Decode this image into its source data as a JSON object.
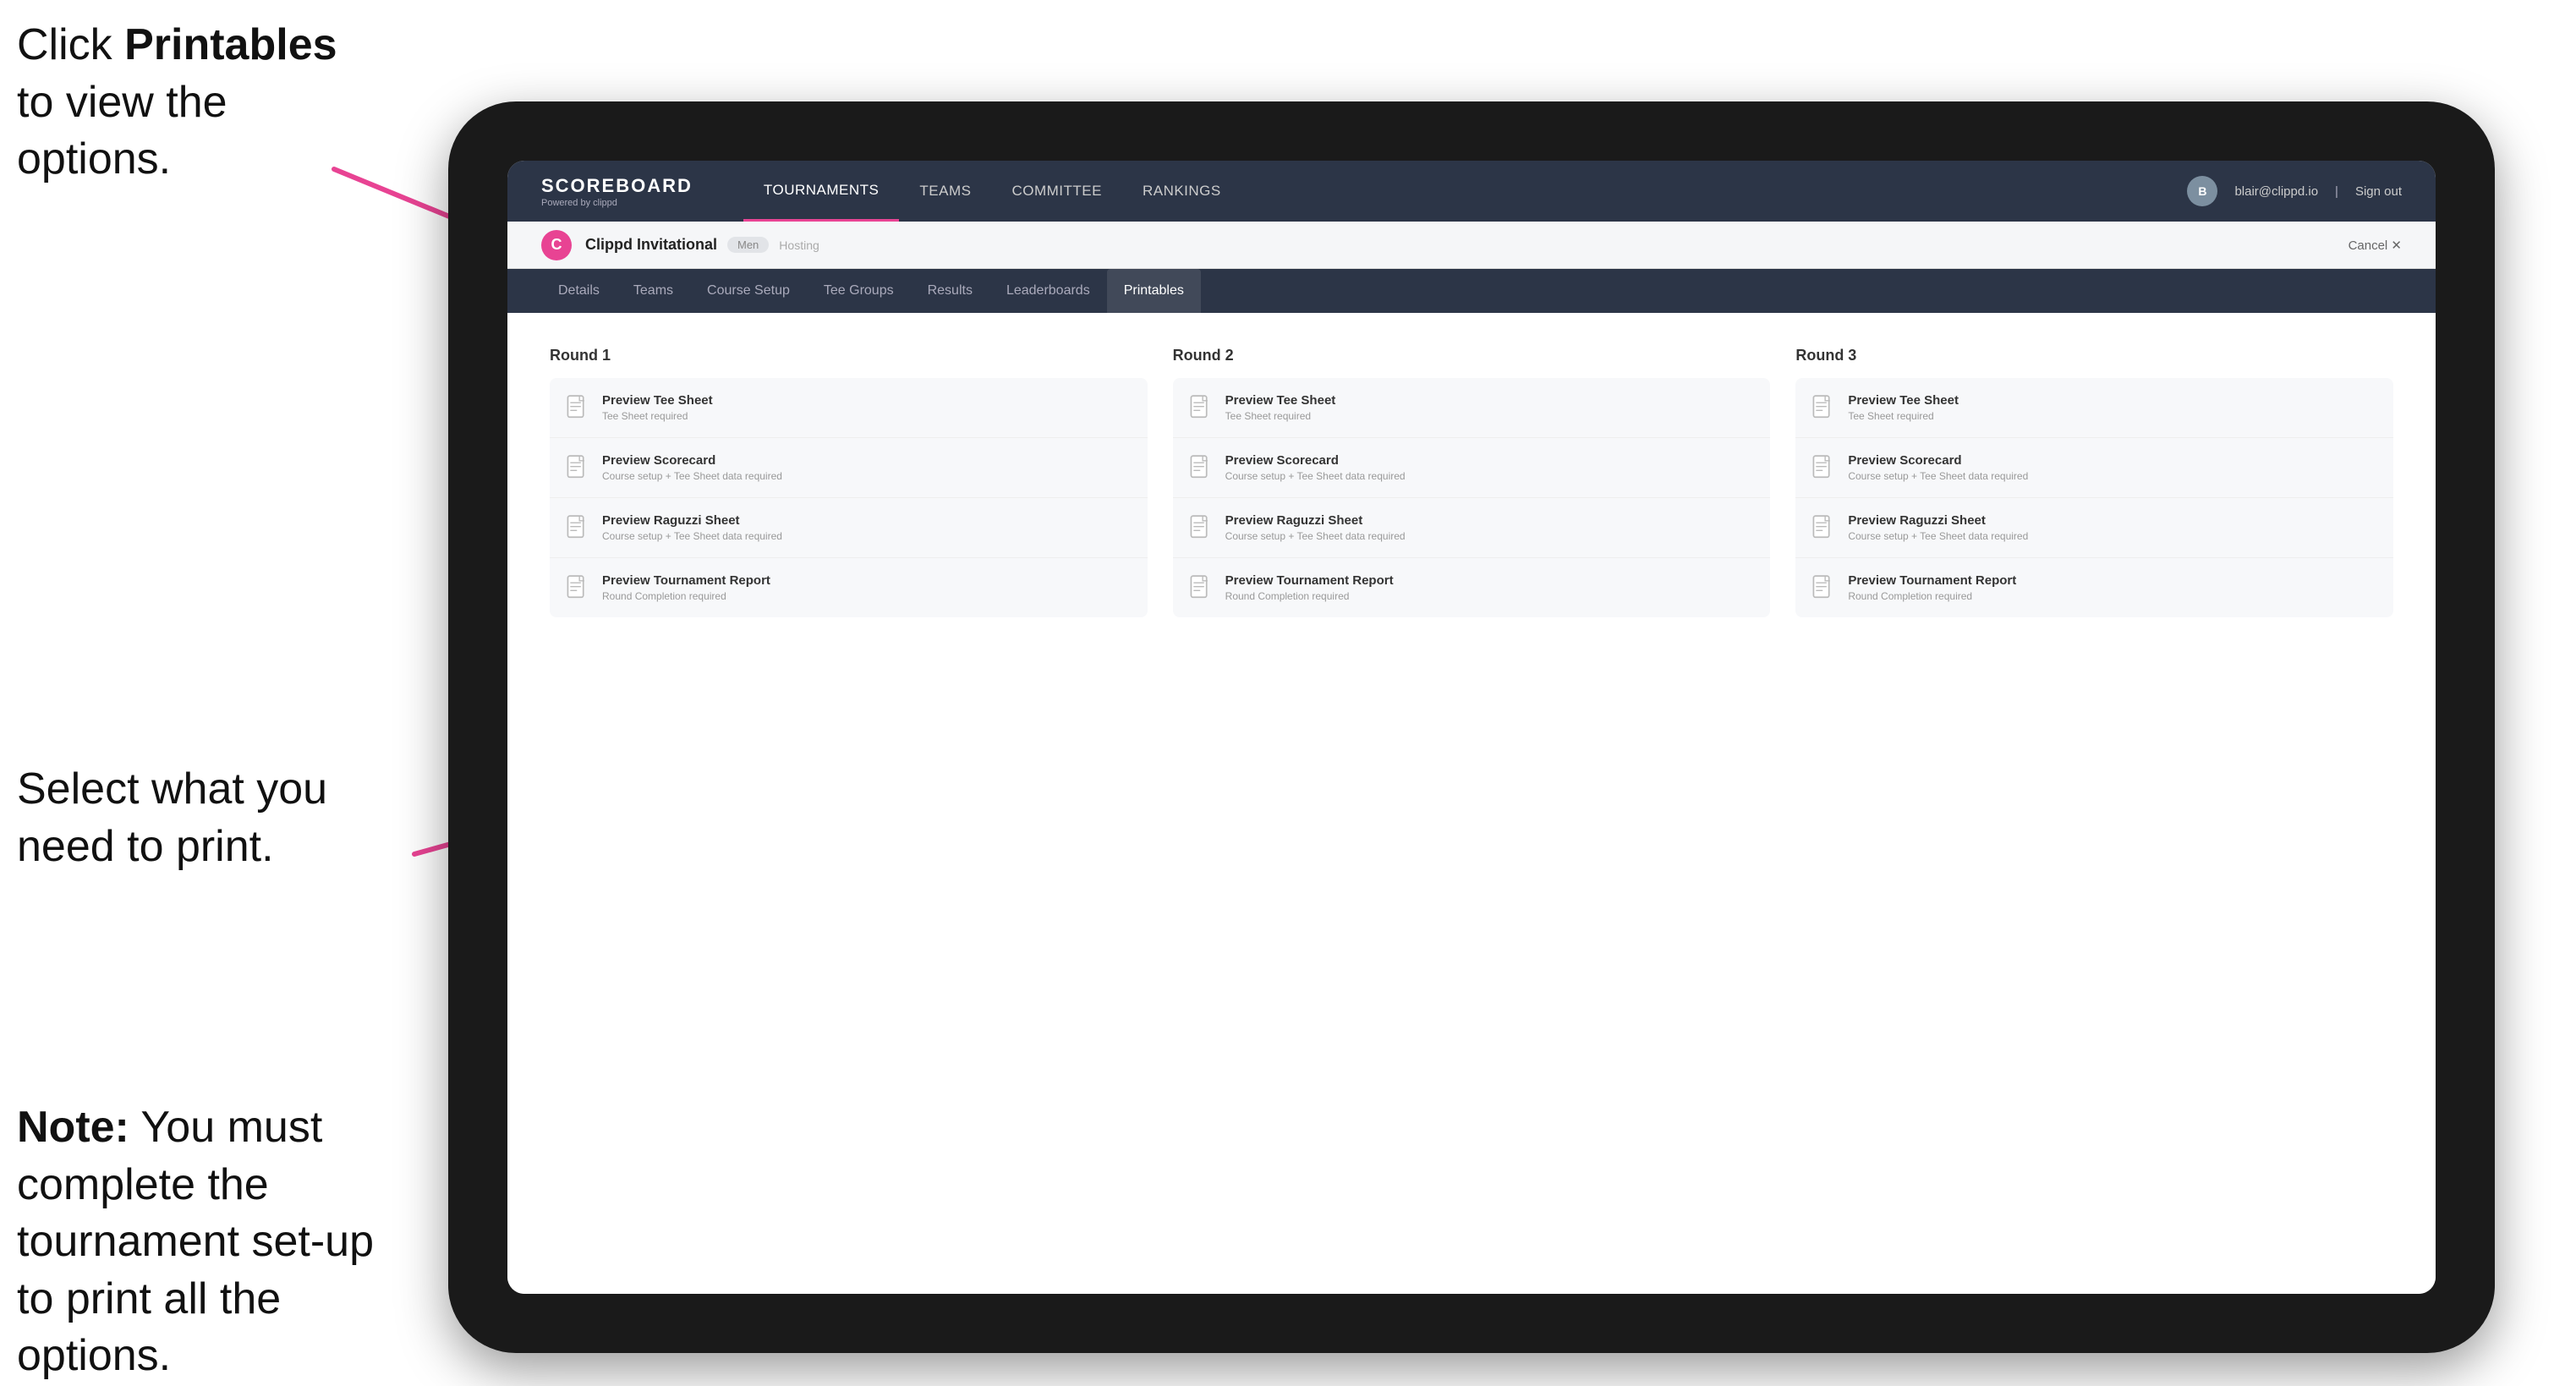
{
  "annotations": {
    "top": "Click ",
    "top_bold": "Printables",
    "top_rest": " to view the options.",
    "mid": "Select what you need to print.",
    "bottom_bold": "Note:",
    "bottom_rest": " You must complete the tournament set-up to print all the options."
  },
  "nav": {
    "brand": "SCOREBOARD",
    "brand_sub": "Powered by clippd",
    "links": [
      "TOURNAMENTS",
      "TEAMS",
      "COMMITTEE",
      "RANKINGS"
    ],
    "active_link": "TOURNAMENTS",
    "user_email": "blair@clippd.io",
    "sign_out": "Sign out",
    "user_initial": "B"
  },
  "tournament": {
    "logo_letter": "C",
    "name": "Clippd Invitational",
    "badge": "Men",
    "hosting": "Hosting",
    "cancel": "Cancel ✕"
  },
  "sub_tabs": [
    "Details",
    "Teams",
    "Course Setup",
    "Tee Groups",
    "Results",
    "Leaderboards",
    "Printables"
  ],
  "active_sub_tab": "Printables",
  "rounds": [
    {
      "label": "Round 1",
      "items": [
        {
          "title": "Preview Tee Sheet",
          "sub": "Tee Sheet required"
        },
        {
          "title": "Preview Scorecard",
          "sub": "Course setup + Tee Sheet data required"
        },
        {
          "title": "Preview Raguzzi Sheet",
          "sub": "Course setup + Tee Sheet data required"
        },
        {
          "title": "Preview Tournament Report",
          "sub": "Round Completion required"
        }
      ]
    },
    {
      "label": "Round 2",
      "items": [
        {
          "title": "Preview Tee Sheet",
          "sub": "Tee Sheet required"
        },
        {
          "title": "Preview Scorecard",
          "sub": "Course setup + Tee Sheet data required"
        },
        {
          "title": "Preview Raguzzi Sheet",
          "sub": "Course setup + Tee Sheet data required"
        },
        {
          "title": "Preview Tournament Report",
          "sub": "Round Completion required"
        }
      ]
    },
    {
      "label": "Round 3",
      "items": [
        {
          "title": "Preview Tee Sheet",
          "sub": "Tee Sheet required"
        },
        {
          "title": "Preview Scorecard",
          "sub": "Course setup + Tee Sheet data required"
        },
        {
          "title": "Preview Raguzzi Sheet",
          "sub": "Course setup + Tee Sheet data required"
        },
        {
          "title": "Preview Tournament Report",
          "sub": "Round Completion required"
        }
      ]
    }
  ]
}
